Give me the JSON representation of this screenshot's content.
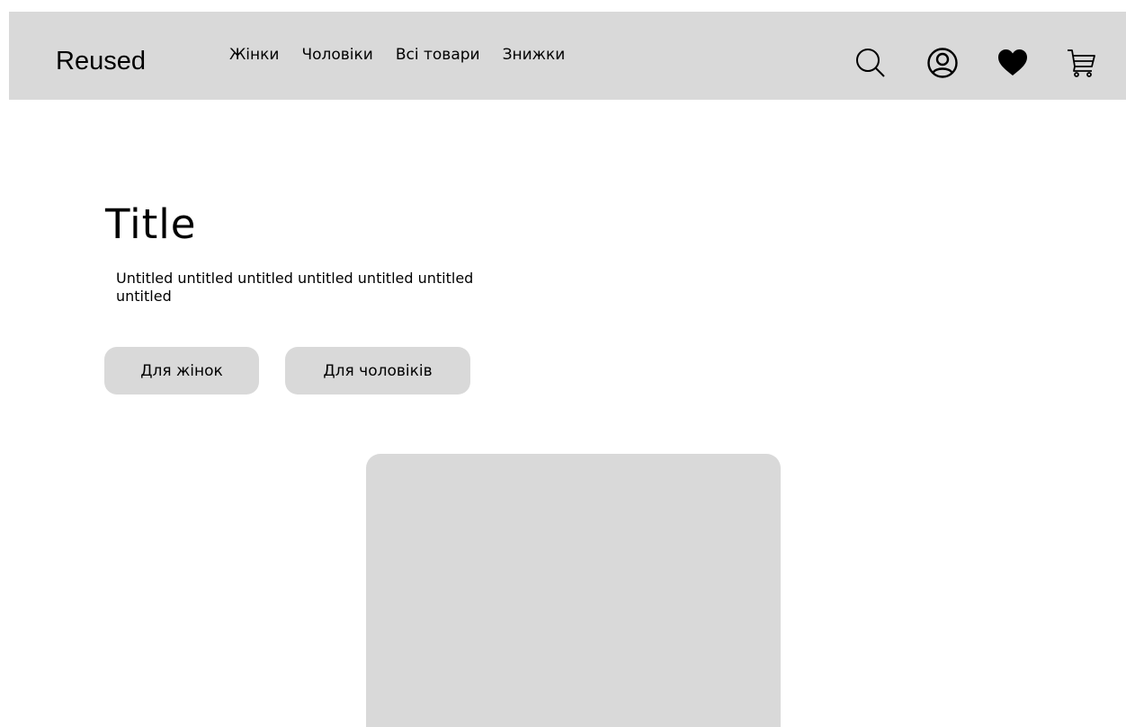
{
  "header": {
    "logo": "Reused",
    "nav": [
      {
        "label": "Жінки"
      },
      {
        "label": "Чоловіки"
      },
      {
        "label": "Всі товари"
      },
      {
        "label": "Знижки"
      }
    ],
    "icons": [
      "search-icon",
      "user-icon",
      "heart-icon",
      "cart-icon"
    ]
  },
  "hero": {
    "title": "Title",
    "subtitle": "Untitled untitled untitled untitled untitled untitled untitled",
    "buttons": {
      "women": "Для жінок",
      "men": "Для чоловіків"
    }
  },
  "colors": {
    "header_bg": "#d9d9d9",
    "button_bg": "#d9d9d9",
    "placeholder_bg": "#d9d9d9",
    "text": "#000000"
  }
}
